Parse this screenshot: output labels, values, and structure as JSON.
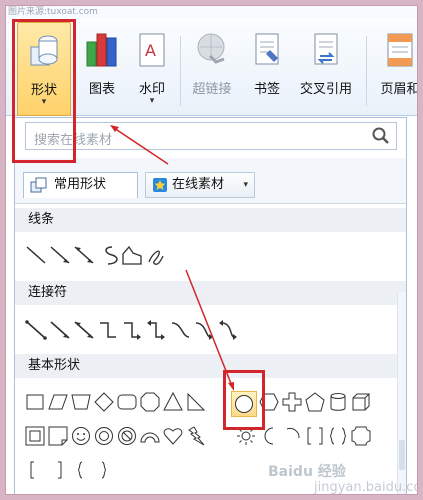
{
  "watermark_top": "图片来源:tuxoat.com",
  "ribbon": {
    "shape_label": "形状",
    "chart_label": "图表",
    "watermark_label": "水印",
    "hyperlink_label": "超链接",
    "bookmark_label": "书签",
    "crossref_label": "交叉引用",
    "header_label": "页眉和",
    "dropdown_glyph": "▾"
  },
  "panel": {
    "search_placeholder": "搜索在线素材",
    "tabs": [
      {
        "label": "常用形状"
      },
      {
        "label": "在线素材",
        "chevron": "▾"
      }
    ],
    "sections": [
      {
        "title": "线条"
      },
      {
        "title": "连接符"
      },
      {
        "title": "基本形状"
      }
    ]
  },
  "watermark_bottom": "Baidu 经验",
  "watermark_bottom_sub": "jingyan.baidu.com"
}
